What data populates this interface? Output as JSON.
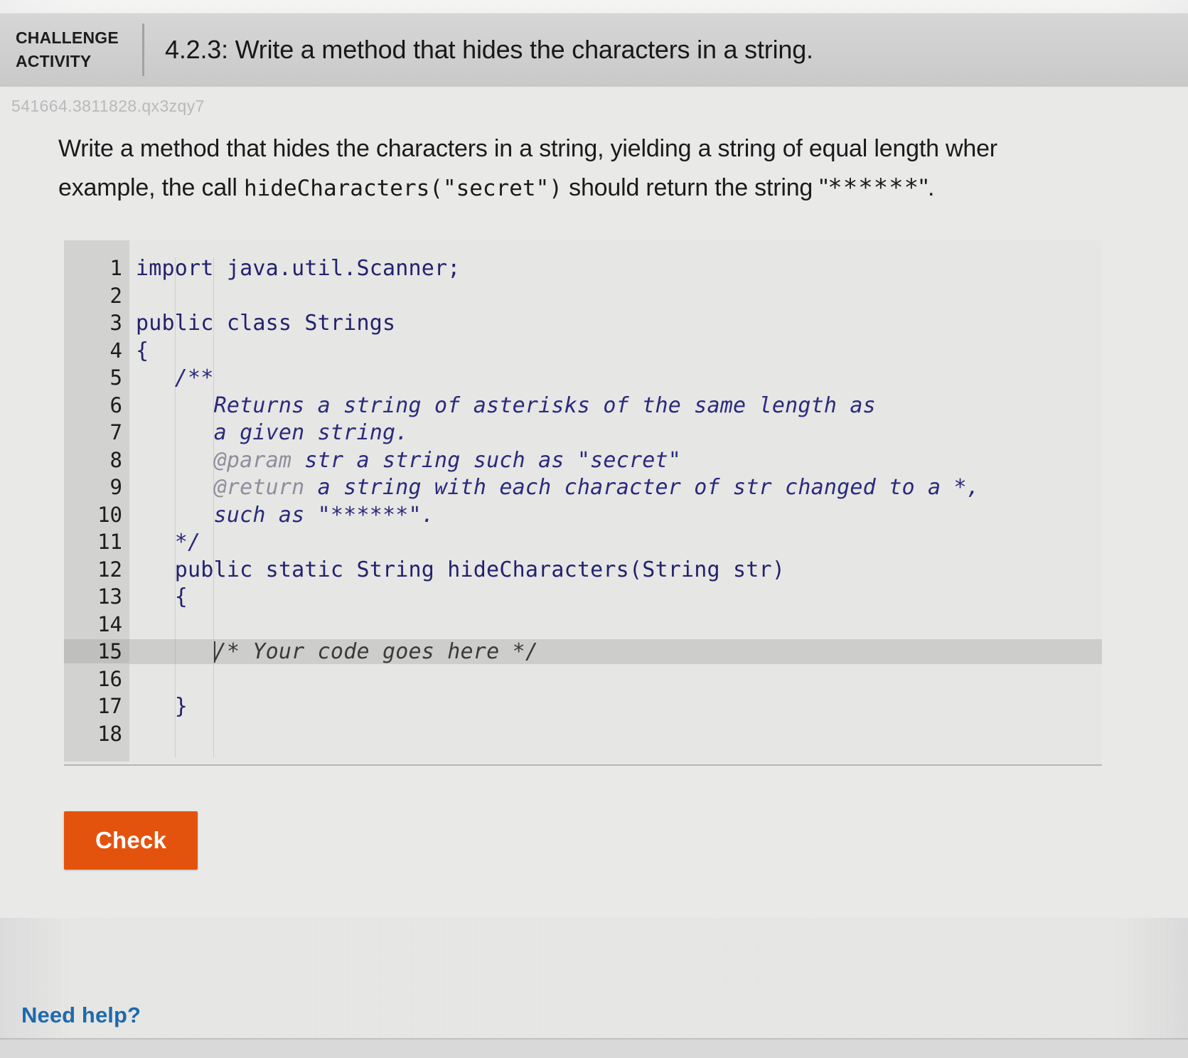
{
  "header": {
    "challenge_label_line1": "CHALLENGE",
    "challenge_label_line2": "ACTIVITY",
    "activity_title": "4.2.3: Write a method that hides the characters in a string."
  },
  "activity_id": "541664.3811828.qx3zqy7",
  "prompt": {
    "line1_before_code": "Write a method that hides the characters in a string, yielding a string of equal length wher",
    "line2_before_code": "example, the call ",
    "line2_code": "hideCharacters(\"secret\")",
    "line2_after_code": " should return the string \"",
    "line2_stars": "******",
    "line2_end": "\"."
  },
  "editor": {
    "lines": [
      {
        "n": "1",
        "text": "import java.util.Scanner;",
        "type": "code",
        "active": false
      },
      {
        "n": "2",
        "text": "",
        "type": "code",
        "active": false
      },
      {
        "n": "3",
        "text": "public class Strings",
        "type": "code",
        "active": false
      },
      {
        "n": "4",
        "text": "{",
        "type": "code",
        "active": false
      },
      {
        "n": "5",
        "text": "   /**",
        "type": "comment",
        "active": false
      },
      {
        "n": "6",
        "text": "      Returns a string of asterisks of the same length as",
        "type": "comment",
        "active": false
      },
      {
        "n": "7",
        "text": "      a given string.",
        "type": "comment",
        "active": false
      },
      {
        "n": "8",
        "tag": "@param",
        "text": " str a string such as \"secret\"",
        "indent": "      ",
        "type": "comment-tag",
        "active": false
      },
      {
        "n": "9",
        "tag": "@return",
        "text": " a string with each character of str changed to a *,",
        "indent": "      ",
        "type": "comment-tag",
        "active": false
      },
      {
        "n": "10",
        "text": "      such as \"******\".",
        "type": "comment",
        "active": false
      },
      {
        "n": "11",
        "text": "   */",
        "type": "comment",
        "active": false
      },
      {
        "n": "12",
        "text": "   public static String hideCharacters(String str)",
        "type": "code",
        "active": false
      },
      {
        "n": "13",
        "text": "   {",
        "type": "code",
        "active": false
      },
      {
        "n": "14",
        "text": "",
        "type": "code",
        "active": false
      },
      {
        "n": "15",
        "text": "/* Your code goes here */",
        "indent": "      ",
        "type": "todo",
        "active": true
      },
      {
        "n": "16",
        "text": "",
        "type": "code",
        "active": false
      },
      {
        "n": "17",
        "text": "   }",
        "type": "code",
        "active": false
      },
      {
        "n": "18",
        "text": "",
        "type": "code",
        "active": false
      }
    ]
  },
  "actions": {
    "check_label": "Check",
    "need_help_label": "Need help?"
  },
  "colors": {
    "accent_button": "#e4530d",
    "link": "#1f6aab",
    "code_text": "#22226e",
    "header_bar": "#cfcfcf"
  }
}
